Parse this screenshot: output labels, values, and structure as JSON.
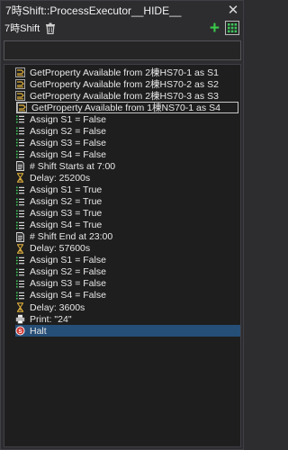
{
  "window": {
    "title": "7時Shift::ProcessExecutor__HIDE__",
    "close_glyph": "✕"
  },
  "toolbar": {
    "label": "7時Shift",
    "add_glyph": "+"
  },
  "colors": {
    "background": "#2d2d30",
    "list_background": "#1e1e1e",
    "selected_row": "#264f78",
    "add_button": "#39c94a",
    "icon_yellow": "#e0b03c",
    "icon_green": "#3cc85a",
    "halt_red": "#d0302a"
  },
  "list": {
    "items": [
      {
        "icon": "get-property-icon",
        "text": "GetProperty Available from 2棟HS70-1 as S1"
      },
      {
        "icon": "get-property-icon",
        "text": "GetProperty Available from 2棟HS70-2 as S2"
      },
      {
        "icon": "get-property-icon",
        "text": "GetProperty Available from 2棟HS70-3 as S3"
      },
      {
        "icon": "get-property-icon",
        "text": "GetProperty Available from 1棟NS70-1 as S4",
        "state": "selected"
      },
      {
        "icon": "assign-icon",
        "text": "Assign S1 = False"
      },
      {
        "icon": "assign-icon",
        "text": "Assign S2 = False"
      },
      {
        "icon": "assign-icon",
        "text": "Assign S3 = False"
      },
      {
        "icon": "assign-icon",
        "text": "Assign S4 = False"
      },
      {
        "icon": "comment-icon",
        "text": "# Shift Starts at 7:00"
      },
      {
        "icon": "delay-icon",
        "text": "Delay: 25200s"
      },
      {
        "icon": "assign-icon",
        "text": "Assign S1 = True"
      },
      {
        "icon": "assign-icon",
        "text": "Assign S2 = True"
      },
      {
        "icon": "assign-icon",
        "text": "Assign S3 = True"
      },
      {
        "icon": "assign-icon",
        "text": "Assign S4 = True"
      },
      {
        "icon": "comment-icon",
        "text": "# Shift End at 23:00"
      },
      {
        "icon": "delay-icon",
        "text": "Delay: 57600s"
      },
      {
        "icon": "assign-icon",
        "text": "Assign S1 = False"
      },
      {
        "icon": "assign-icon",
        "text": "Assign S2 = False"
      },
      {
        "icon": "assign-icon",
        "text": "Assign S3 = False"
      },
      {
        "icon": "assign-icon",
        "text": "Assign S4 = False"
      },
      {
        "icon": "delay-icon",
        "text": "Delay: 3600s"
      },
      {
        "icon": "print-icon",
        "text": "Print: \"24\""
      },
      {
        "icon": "halt-icon",
        "text": "Halt",
        "state": "active"
      }
    ]
  }
}
